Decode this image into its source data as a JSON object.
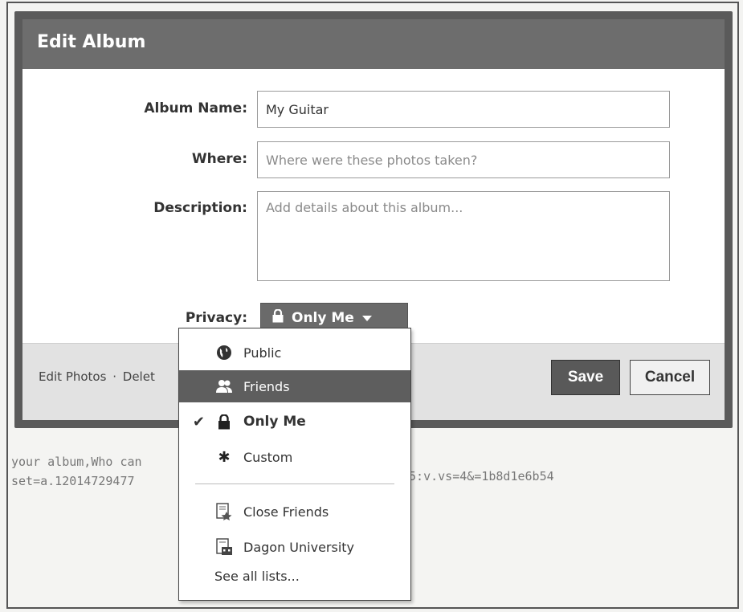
{
  "dialog": {
    "title": "Edit Album",
    "fields": {
      "album_name": {
        "label": "Album Name:",
        "value": "My Guitar"
      },
      "where": {
        "label": "Where:",
        "placeholder": "Where were these photos taken?"
      },
      "description": {
        "label": "Description:",
        "placeholder": "Add details about this album..."
      },
      "privacy": {
        "label": "Privacy:",
        "value": "Only Me"
      }
    },
    "footer": {
      "edit_photos": "Edit Photos",
      "separator": "·",
      "delete_partial": "Delet",
      "save_label": "Save",
      "cancel_label": "Cancel"
    }
  },
  "privacy_menu": {
    "items": [
      {
        "label": "Public",
        "icon": "globe-icon"
      },
      {
        "label": "Friends",
        "icon": "friends-icon",
        "highlighted": true
      },
      {
        "label": "Only Me",
        "icon": "lock-icon",
        "selected": true
      },
      {
        "label": "Custom",
        "icon": "gear-icon"
      },
      {
        "label": "Close Friends",
        "icon": "star-list-icon"
      },
      {
        "label": "Dagon University",
        "icon": "building-list-icon"
      },
      {
        "label": "See all lists..."
      }
    ]
  },
  "background": {
    "line1": "your album,Who can",
    "line2": "set=a.12014729477",
    "line3": "s5:v.vs=4&=1b8d1e6b54"
  },
  "colors": {
    "titlebar": "#6d6d6d",
    "highlight": "#5e5e5e",
    "save_button": "#595959"
  }
}
